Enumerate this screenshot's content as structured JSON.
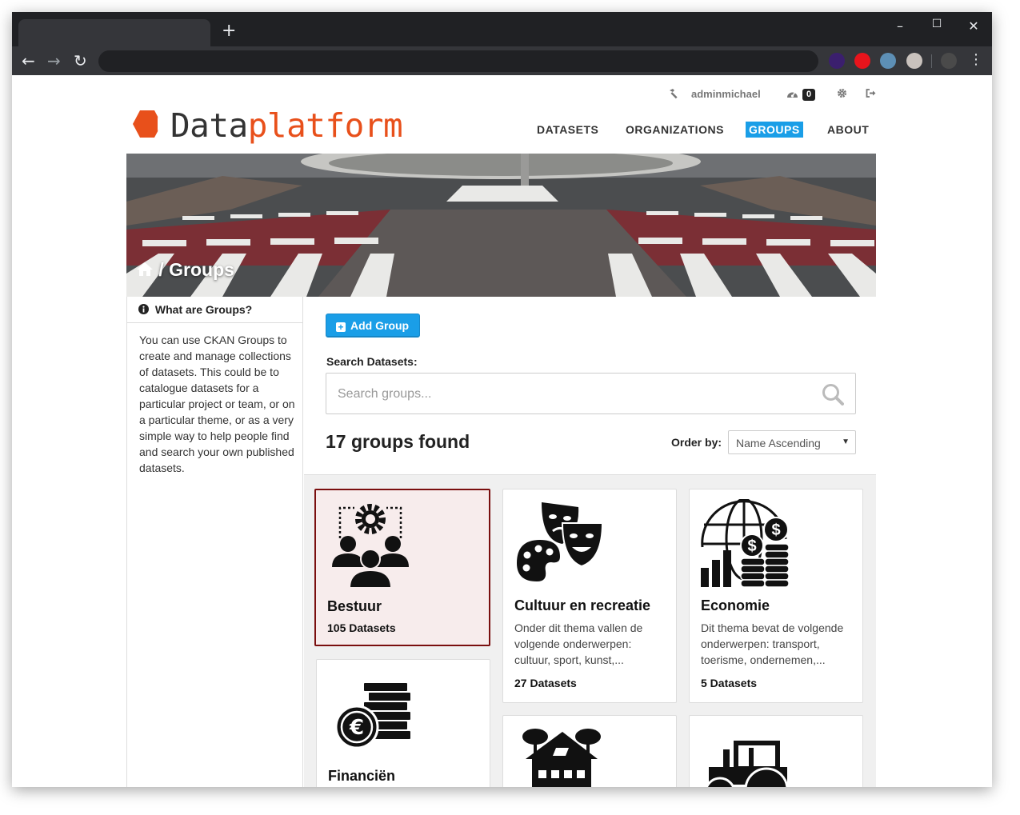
{
  "browser": {
    "new_tab": "+",
    "minimize": "–",
    "maximize": "☐",
    "close": "✕",
    "back": "←",
    "forward": "→",
    "reload": "↻",
    "menu": "⋮",
    "extension_colors": [
      "#3b1f6e",
      "#e8141c",
      "#5d8fb5",
      "#c9c2bd",
      "#4a4a4a"
    ]
  },
  "account": {
    "username": "adminmichael",
    "dashboard_count": "0"
  },
  "logo": {
    "part1": "Data",
    "part2": "platform",
    "color": "#e8501b"
  },
  "nav": {
    "items": [
      "DATASETS",
      "ORGANIZATIONS",
      "GROUPS",
      "ABOUT"
    ],
    "active": "GROUPS"
  },
  "hero": {
    "crumb_separator": "/",
    "title": "Groups"
  },
  "sidebar": {
    "heading": "What are Groups?",
    "body": "You can use CKAN Groups to create and manage collections of datasets. This could be to catalogue datasets for a particular project or team, or on a particular theme, or as a very simple way to help people find and search your own published datasets."
  },
  "content": {
    "add_group_label": "Add Group",
    "search_label": "Search Datasets:",
    "search_placeholder": "Search groups...",
    "found_text": "17 groups found",
    "order_label": "Order by:",
    "order_value": "Name Ascending"
  },
  "groups": [
    {
      "title": "Bestuur",
      "description": "",
      "count": "105 Datasets",
      "icon": "governance-people-gear-icon"
    },
    {
      "title": "Cultuur en recreatie",
      "description": "Onder dit thema vallen de volgende onderwerpen: cultuur, sport, kunst,...",
      "count": "27 Datasets",
      "icon": "theatre-masks-palette-icon"
    },
    {
      "title": "Economie",
      "description": "Dit thema bevat de volgende onderwerpen: transport, toerisme, ondernemen,...",
      "count": "5 Datasets",
      "icon": "globe-coins-chart-icon"
    },
    {
      "title": "Financiën",
      "description": "",
      "count": "",
      "icon": "euro-coins-icon"
    },
    {
      "title": "",
      "description": "",
      "count": "",
      "icon": "house-trees-icon"
    },
    {
      "title": "",
      "description": "",
      "count": "",
      "icon": "tractor-icon"
    }
  ],
  "colors": {
    "accent": "#1a9ee7",
    "selected_border": "#7a0f0f"
  }
}
